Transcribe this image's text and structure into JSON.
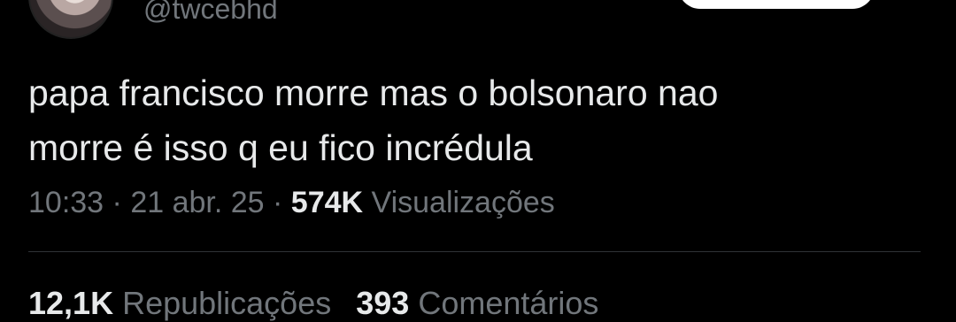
{
  "author": {
    "handle": "@twcebhd"
  },
  "tweet": {
    "line1": "papa francisco morre mas o bolsonaro nao",
    "line2": "morre é isso q eu fico incrédula"
  },
  "meta": {
    "time": "10:33",
    "sep1": " · ",
    "date": "21 abr. 25",
    "sep2": " · ",
    "views_count": "574K",
    "views_label": " Visualizações"
  },
  "stats": {
    "reposts_count": "12,1K",
    "reposts_label": " Republicações",
    "comments_count": "393",
    "comments_label": " Comentários"
  }
}
